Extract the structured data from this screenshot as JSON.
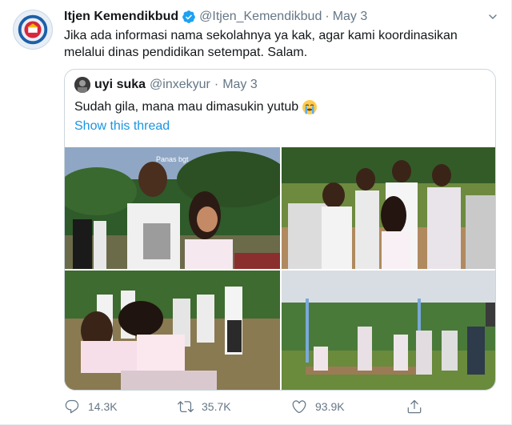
{
  "tweet": {
    "display_name": "Itjen Kemendikbud",
    "handle": "@Itjen_Kemendikbud",
    "separator": "·",
    "date": "May 3",
    "text": "Jika ada informasi nama sekolahnya ya kak, agar kami koordinasikan melalui dinas pendidikan setempat. Salam.",
    "verified_icon": "verified-badge-icon",
    "menu_icon": "chevron-down-icon"
  },
  "quoted": {
    "display_name": "uyi suka",
    "handle": "@inxekyur",
    "separator": "·",
    "date": "May 3",
    "text": "Sudah gila, mana mau dimasukin yutub",
    "emoji": "loudly-crying-face-emoji",
    "thread_link": "Show this thread",
    "photo_caption": "Panas bgt"
  },
  "actions": {
    "reply_count": "14.3K",
    "retweet_count": "35.7K",
    "like_count": "93.9K",
    "reply_icon": "reply-icon",
    "retweet_icon": "retweet-icon",
    "like_icon": "heart-icon",
    "share_icon": "share-icon"
  },
  "colors": {
    "link_blue": "#1b95e0",
    "muted_gray": "#657786",
    "text_dark": "#14171a",
    "border": "#ccd6dd"
  }
}
